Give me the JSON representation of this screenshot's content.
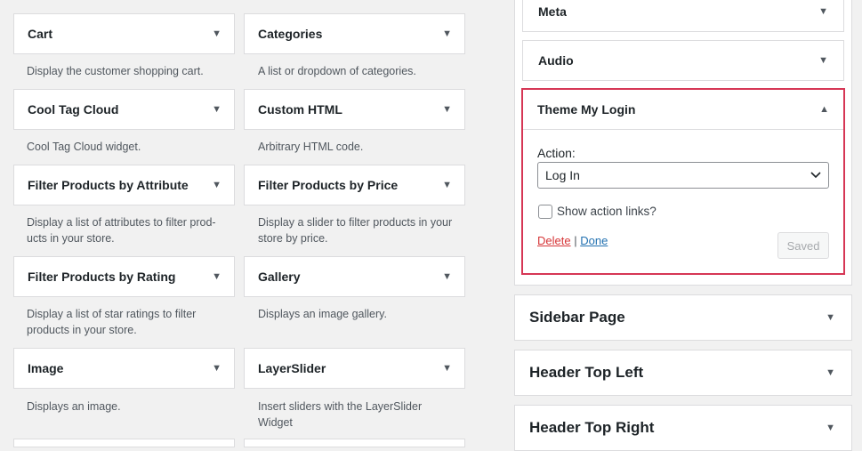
{
  "available_widgets": [
    {
      "title": "Cart",
      "description": "Display the customer shopping cart."
    },
    {
      "title": "Categories",
      "description": "A list or dropdown of categories."
    },
    {
      "title": "Cool Tag Cloud",
      "description": "Cool Tag Cloud widget."
    },
    {
      "title": "Custom HTML",
      "description": "Arbitrary HTML code."
    },
    {
      "title": "Filter Products by Attribute",
      "description_lines": [
        "Display a list of attributes to filter prod-",
        "ucts in your store."
      ]
    },
    {
      "title": "Filter Products by Price",
      "description_lines": [
        "Display a slider to filter products in your",
        "store by price."
      ]
    },
    {
      "title": "Filter Products by Rating",
      "description_lines": [
        "Display a list of star ratings to filter",
        "products in your store."
      ]
    },
    {
      "title": "Gallery",
      "description": "Displays an image gallery."
    },
    {
      "title": "Image",
      "description": "Displays an image."
    },
    {
      "title": "LayerSlider",
      "description_lines": [
        "Insert sliders with the LayerSlider",
        "Widget"
      ]
    }
  ],
  "sidebar_widgets": {
    "meta": {
      "title": "Meta"
    },
    "audio": {
      "title": "Audio"
    },
    "theme_my_login": {
      "title": "Theme My Login",
      "action_label": "Action:",
      "action_value": "Log In",
      "show_links_label": "Show action links?",
      "show_links_checked": false,
      "delete_label": "Delete",
      "separator": "|",
      "done_label": "Done",
      "saved_label": "Saved"
    }
  },
  "widget_areas": [
    {
      "title": "Sidebar Page"
    },
    {
      "title": "Header Top Left"
    },
    {
      "title": "Header Top Right"
    }
  ],
  "colors": {
    "background": "#f1f1f1",
    "highlight_border": "#d63655",
    "delete_link": "#d63638",
    "done_link": "#2271b1"
  },
  "icons": {
    "collapsed": "triangle-down",
    "expanded": "triangle-up"
  }
}
